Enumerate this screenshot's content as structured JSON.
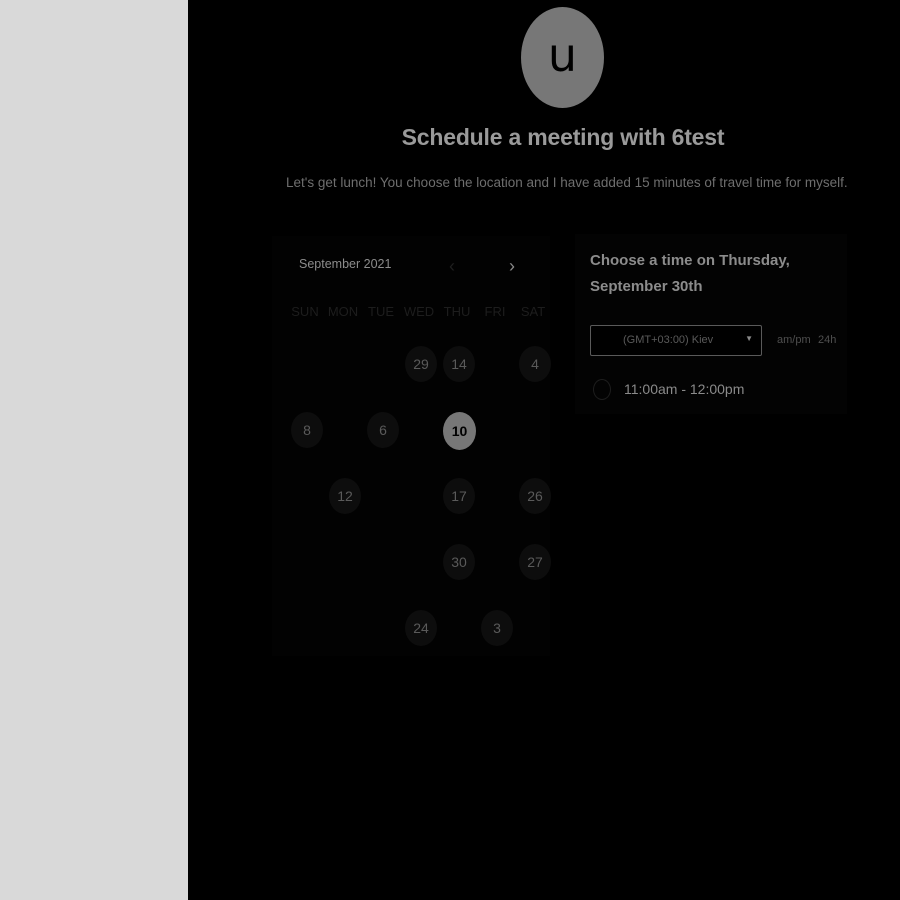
{
  "profile": {
    "avatar_letter": "u"
  },
  "header": {
    "title": "Schedule a meeting with 6test",
    "description": "Let's get lunch! You choose the location and I have added 15 minutes of travel time for myself."
  },
  "calendar": {
    "month_label": "September 2021",
    "prev_icon": "chevron-left-icon",
    "next_icon": "chevron-right-icon",
    "weekdays": [
      "SUN",
      "MON",
      "TUE",
      "WED",
      "THU",
      "FRI",
      "SAT"
    ],
    "days": [
      {
        "label": "29",
        "row": 0,
        "col": 3,
        "state": "available"
      },
      {
        "label": "14",
        "row": 0,
        "col": 4,
        "state": "available"
      },
      {
        "label": "4",
        "row": 0,
        "col": 6,
        "state": "available"
      },
      {
        "label": "8",
        "row": 1,
        "col": 0,
        "state": "available"
      },
      {
        "label": "6",
        "row": 1,
        "col": 2,
        "state": "available"
      },
      {
        "label": "10",
        "row": 1,
        "col": 4,
        "state": "selected"
      },
      {
        "label": "12",
        "row": 2,
        "col": 1,
        "state": "available"
      },
      {
        "label": "17",
        "row": 2,
        "col": 4,
        "state": "available"
      },
      {
        "label": "26",
        "row": 2,
        "col": 6,
        "state": "available"
      },
      {
        "label": "30",
        "row": 3,
        "col": 4,
        "state": "available"
      },
      {
        "label": "27",
        "row": 3,
        "col": 6,
        "state": "available"
      },
      {
        "label": "24",
        "row": 4,
        "col": 3,
        "state": "available"
      },
      {
        "label": "3",
        "row": 4,
        "col": 5,
        "state": "available"
      }
    ]
  },
  "time_panel": {
    "heading": "Choose a time on Thursday, September 30th",
    "timezone": "(GMT+03:00) Kiev",
    "format_ampm": "am/pm",
    "format_24h": "24h",
    "slots": [
      "11:00am - 12:00pm"
    ]
  },
  "colors": {
    "side_panel": "#d9d9d9",
    "background": "#000000",
    "avatar": "#777777",
    "selected_day": "#777777"
  }
}
